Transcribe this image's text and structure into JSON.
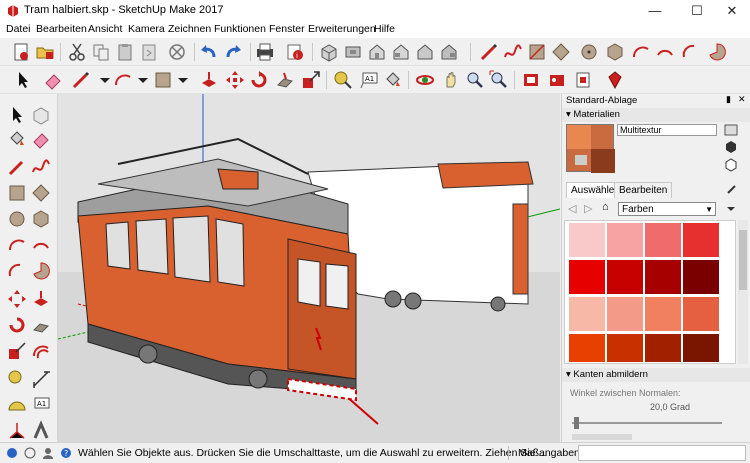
{
  "window": {
    "title": "Tram halbiert.skp - SketchUp Make 2017",
    "minimize": "—",
    "maximize": "☐",
    "close": "✕"
  },
  "menu": [
    "Datei",
    "Bearbeiten",
    "Ansicht",
    "Kamera",
    "Zeichnen",
    "Funktionen",
    "Fenster",
    "Erweiterungen",
    "Hilfe"
  ],
  "toolbar_top_icons": [
    "new-file-icon",
    "open-icon",
    "save-icon",
    "cut-icon",
    "copy-icon",
    "paste-icon",
    "erase-icon",
    "undo-icon",
    "redo-icon",
    "print-icon",
    "model-info-icon",
    "iso-view-icon",
    "top-view-icon",
    "front-view-icon",
    "right-view-icon",
    "back-view-icon",
    "left-view-icon",
    "pencil-icon",
    "freehand-icon",
    "rectangle-icon",
    "rotated-rectangle-icon",
    "circle-icon",
    "polygon-icon",
    "arc-icon",
    "two-point-arc-icon",
    "three-point-arc-icon",
    "pie-icon"
  ],
  "toolbar_second_icons": [
    "select-icon",
    "eraser-icon",
    "line-icon",
    "arc-dropdown-icon",
    "shape-dropdown-icon",
    "push-pull-icon",
    "move-icon",
    "rotate-icon",
    "follow-me-icon",
    "scale-icon",
    "tape-measure-icon",
    "text-icon",
    "paint-bucket-icon",
    "orbit-icon",
    "pan-icon",
    "zoom-icon",
    "zoom-extents-icon",
    "3d-warehouse-icon",
    "extension-warehouse-icon",
    "layout-icon",
    "ruby-icon"
  ],
  "left_tools": [
    "select-icon",
    "component-icon",
    "paint-bucket-icon",
    "eraser-icon",
    "pencil-icon",
    "freehand-icon",
    "rectangle-icon",
    "rotated-rectangle-icon",
    "circle-icon",
    "polygon-icon",
    "arc-icon",
    "two-point-arc-icon",
    "three-point-arc-icon",
    "pie-icon",
    "move-icon",
    "push-pull-icon",
    "rotate-icon",
    "follow-me-icon",
    "scale-icon",
    "offset-icon",
    "tape-measure-icon",
    "dimension-icon",
    "protractor-icon",
    "text-icon",
    "axes-icon",
    "3d-text-icon"
  ],
  "panel": {
    "tray_title": "Standard-Ablage",
    "materials_title": "Materialien",
    "material_name": "Multitextur",
    "tab_select": "Auswählen",
    "tab_edit": "Bearbeiten",
    "library": "Farben",
    "soften_title": "Kanten abmildern",
    "angle_label": "Winkel zwischen Normalen:",
    "angle_value": "20,0  Grad",
    "swatch_colors": [
      "#f9c9c9",
      "#f7a3a3",
      "#f06b6b",
      "#e63030",
      "#e60000",
      "#c70000",
      "#a60000",
      "#7a0000",
      "#f8b8a8",
      "#f49a88",
      "#f08060",
      "#e56040",
      "#e84000",
      "#c83000",
      "#a02000",
      "#7a1500"
    ]
  },
  "status": {
    "text": "Wählen Sie Objekte aus. Drücken Sie die Umschalttaste, um die Auswahl zu erweitern. Ziehen Sie ...",
    "measure_label": "Maßangaben"
  },
  "colors": {
    "tram_body": "#d9612f",
    "tram_roof": "#9e9e9e",
    "axis_red": "#cc0000",
    "axis_green": "#009900",
    "axis_blue": "#2255cc"
  }
}
